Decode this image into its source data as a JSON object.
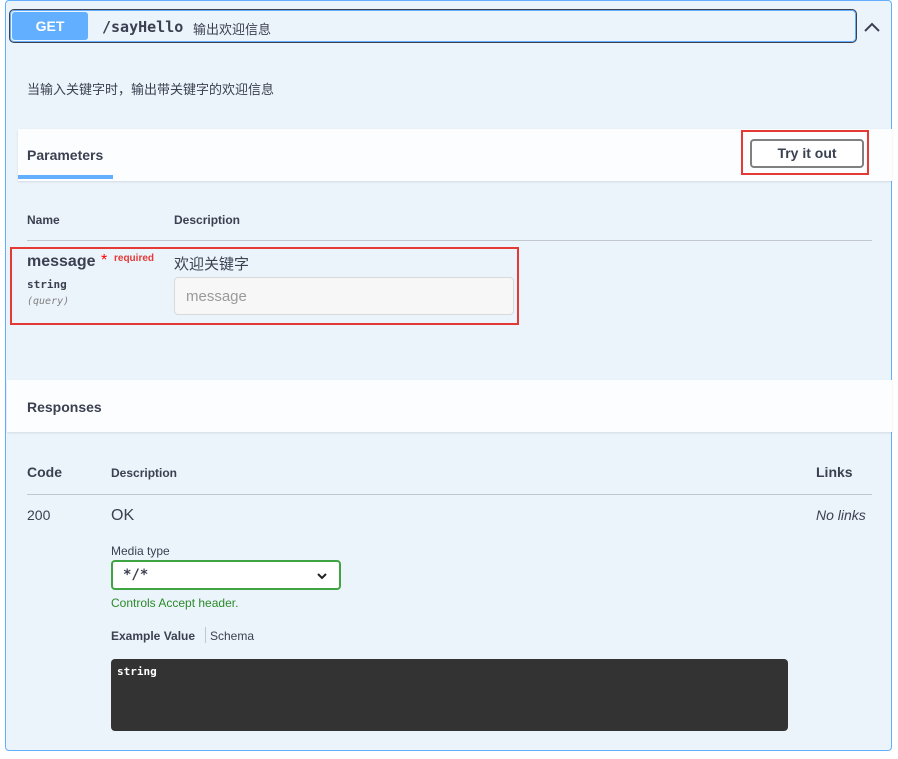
{
  "operation": {
    "method": "GET",
    "path": "/sayHello",
    "summary": "输出欢迎信息",
    "description": "当输入关键字时，输出带关键字的欢迎信息"
  },
  "parameters": {
    "title": "Parameters",
    "try_label": "Try it out",
    "col_name": "Name",
    "col_desc": "Description",
    "items": [
      {
        "name": "message",
        "star": "*",
        "required": "required",
        "type": "string",
        "in": "(query)",
        "description": "欢迎关键字",
        "placeholder": "message"
      }
    ]
  },
  "responses": {
    "title": "Responses",
    "col_code": "Code",
    "col_desc": "Description",
    "col_links": "Links",
    "rows": [
      {
        "code": "200",
        "description": "OK",
        "links": "No links",
        "media_label": "Media type",
        "media_value": "*/*",
        "controls_note": "Controls Accept header.",
        "example_tab": "Example Value",
        "schema_tab": "Schema",
        "example_code": "string"
      }
    ]
  },
  "colors": {
    "get_accent": "#61affe",
    "highlight": "#e53935",
    "media_border": "#41a443"
  },
  "icons": {
    "collapse": "chevron-up-icon",
    "media_dropdown": "chevron-down-icon"
  }
}
